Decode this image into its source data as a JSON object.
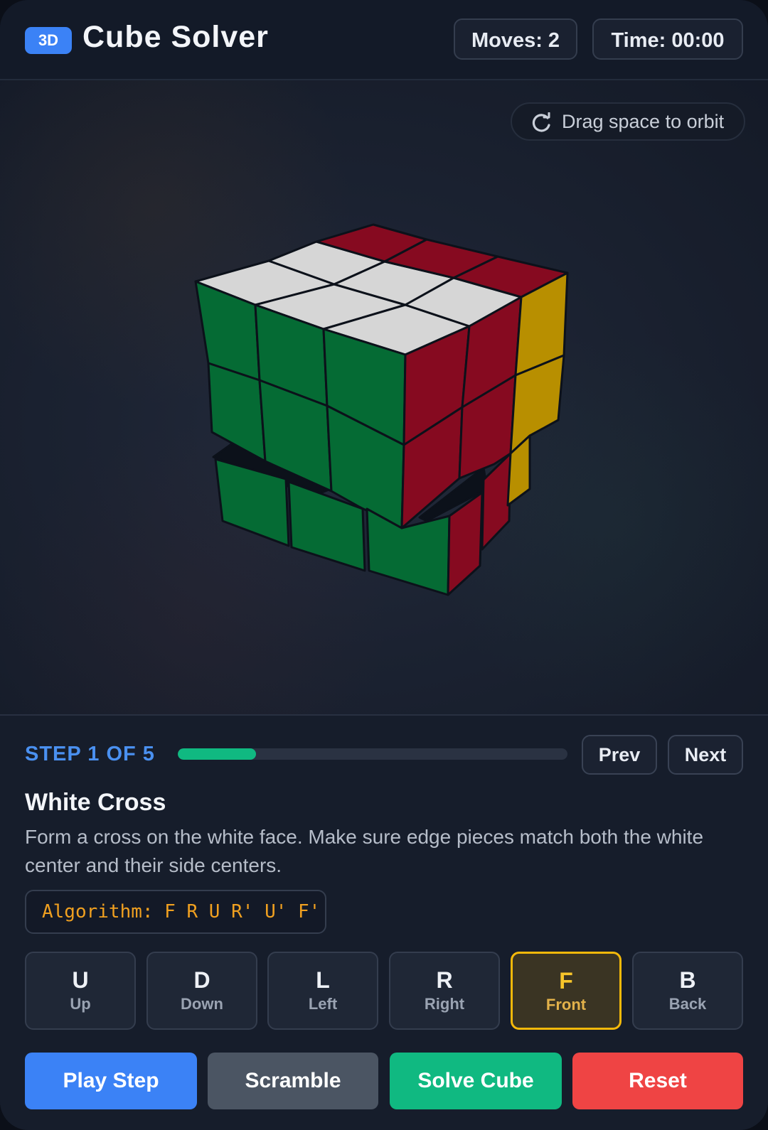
{
  "header": {
    "badge": "3D",
    "title": "Cube Solver",
    "moves": "Moves: 2",
    "time": "Time: 00:00"
  },
  "viewport": {
    "orbit_hint": "Drag space to orbit",
    "orbit_icon": "rotate-icon"
  },
  "cube_colors": {
    "white": "#d6d6d6",
    "green": "#056b34",
    "red": "#860a20",
    "yellow": "#b88f00"
  },
  "step": {
    "label": "STEP 1 OF 5",
    "progress": 0.2,
    "prev": "Prev",
    "next": "Next",
    "title": "White Cross",
    "description": "Form a cross on the white face. Make sure edge pieces match both the white center and their side centers.",
    "algorithm": "Algorithm: F R U R' U' F'"
  },
  "moves": [
    {
      "key": "U",
      "name": "Up",
      "active": false
    },
    {
      "key": "D",
      "name": "Down",
      "active": false
    },
    {
      "key": "L",
      "name": "Left",
      "active": false
    },
    {
      "key": "R",
      "name": "Right",
      "active": false
    },
    {
      "key": "F",
      "name": "Front",
      "active": true
    },
    {
      "key": "B",
      "name": "Back",
      "active": false
    }
  ],
  "actions": {
    "play": "Play Step",
    "scramble": "Scramble",
    "solve": "Solve Cube",
    "reset": "Reset"
  }
}
